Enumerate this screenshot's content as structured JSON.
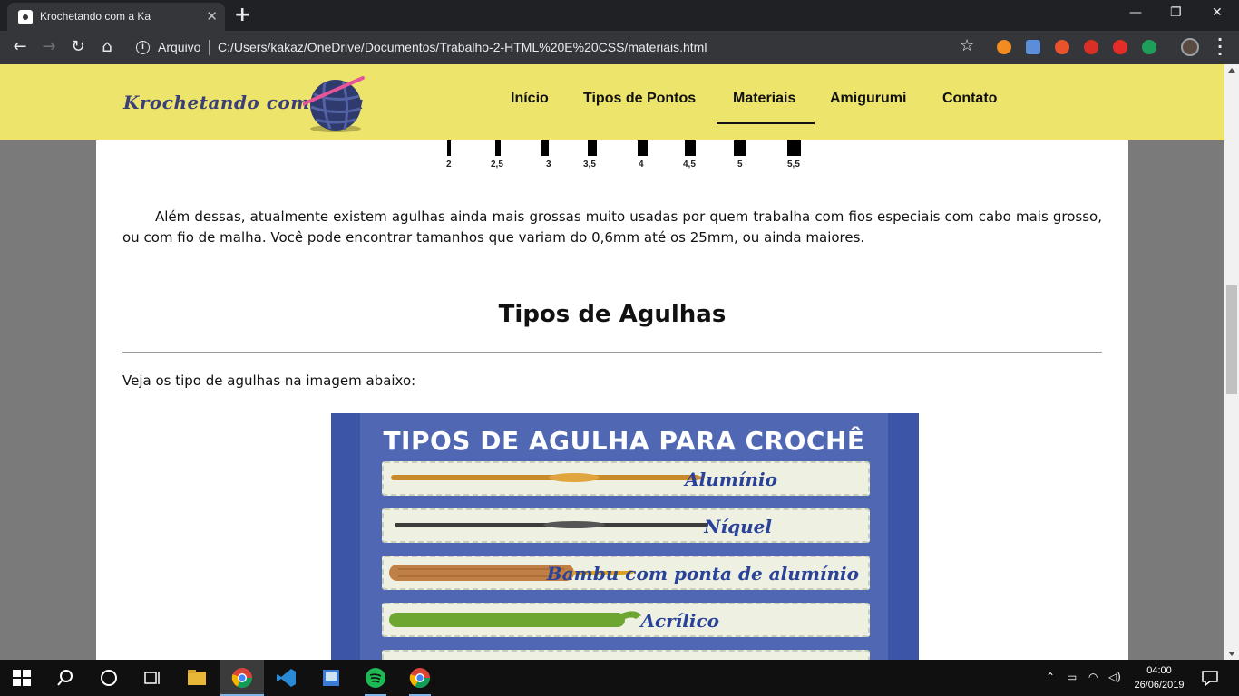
{
  "browser": {
    "tab_title": "Krochetando com a Ka",
    "tab_close": "✕",
    "new_tab": "+",
    "omnibox_scheme": "Arquivo",
    "omnibox_url": "C:/Users/kakaz/OneDrive/Documentos/Trabalho-2-HTML%20E%20CSS/materiais.html"
  },
  "site": {
    "logo_text": "Krochetando com a Ka",
    "nav": [
      {
        "label": "Início",
        "active": false
      },
      {
        "label": "Tipos de Pontos",
        "active": false
      },
      {
        "label": "Materiais",
        "active": true
      },
      {
        "label": "Amigurumi",
        "active": false
      },
      {
        "label": "Contato",
        "active": false
      }
    ],
    "colors": {
      "header_bg": "#ede46b",
      "logo": "#3a3f78",
      "accent_pink": "#e6559a"
    }
  },
  "content": {
    "ruler_sizes": [
      "2",
      "2,5",
      "3",
      "3,5",
      "4",
      "4,5",
      "5",
      "5,5"
    ],
    "paragraph_1": "Além dessas, atualmente existem agulhas ainda mais grossas muito usadas por quem trabalha com fios especiais com cabo mais grosso, ou com fio de malha. Você pode encontrar tamanhos que variam do 0,6mm até os 25mm, ou ainda maiores.",
    "heading": "Tipos de Agulhas",
    "paragraph_2": "Veja os tipo de agulhas na imagem abaixo:",
    "infographic": {
      "title": "TIPOS DE AGULHA PARA CROCHÊ",
      "items": [
        "Alumínio",
        "Níquel",
        "Bambu com ponta de alumínio",
        "Acrílico"
      ]
    }
  },
  "taskbar": {
    "time": "04:00",
    "date": "26/06/2019"
  }
}
